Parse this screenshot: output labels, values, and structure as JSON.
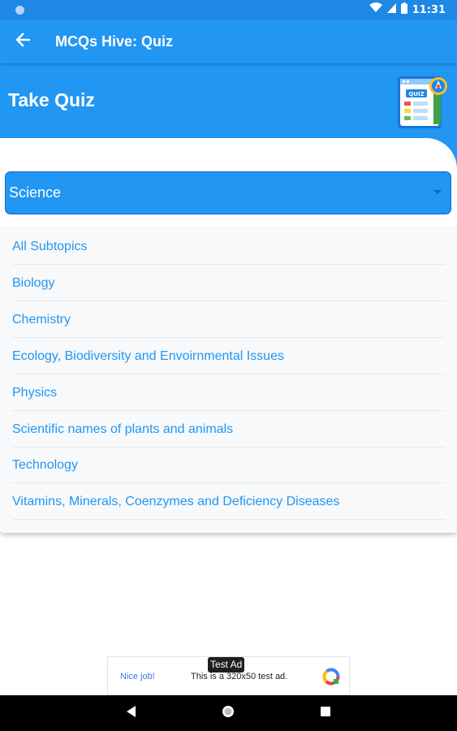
{
  "status_bar": {
    "time": "11:31",
    "icons": [
      "notification-dot-icon",
      "wifi-icon",
      "signal-icon",
      "battery-icon"
    ]
  },
  "app_bar": {
    "title": "MCQs Hive: Quiz",
    "back_icon": "arrow-back-icon"
  },
  "header": {
    "title": "Take Quiz",
    "logo_text": "QUIZ"
  },
  "dropdown": {
    "selected": "Science"
  },
  "subtopics": [
    "All Subtopics",
    "Biology",
    "Chemistry",
    "Ecology, Biodiversity and Envoirnmental Issues",
    "Physics",
    "Scientific names of plants and animals",
    "Technology",
    "Vitamins, Minerals, Coenzymes and Deficiency Diseases"
  ],
  "ad": {
    "label": "Test Ad",
    "left_text": "Nice job!",
    "body_text": "This is a 320x50 test ad."
  },
  "nav": {
    "icons": [
      "nav-back-icon",
      "nav-home-icon",
      "nav-recents-icon"
    ]
  },
  "colors": {
    "primary": "#2196f3",
    "status_bar": "#1e88e5",
    "link_text": "#2196f3"
  }
}
